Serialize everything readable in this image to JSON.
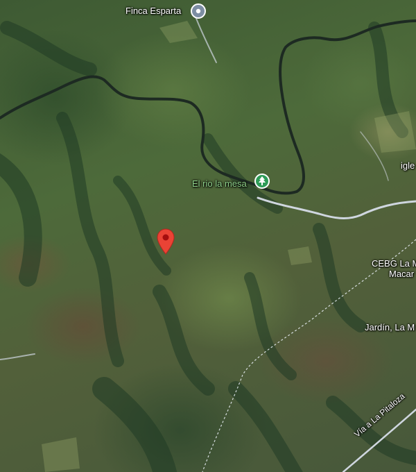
{
  "map": {
    "view": "satellite",
    "labels": {
      "finca": "Finca Esparta",
      "river": "El rio la mesa",
      "igle": "igle",
      "cebg_line1": "CEBG La M",
      "cebg_line2": "Macar",
      "jardin": "Jardín, La M",
      "road": "Vía a La Pitaloza"
    },
    "colors": {
      "pin": "#ea4335",
      "poi_place": "#7d8ea3",
      "poi_park": "#2e9b57",
      "river": "#1d2a22",
      "road": "#cfd6df"
    },
    "icons": {
      "finca": "place-icon",
      "park": "tree-icon",
      "pin": "location-pin-icon"
    }
  }
}
